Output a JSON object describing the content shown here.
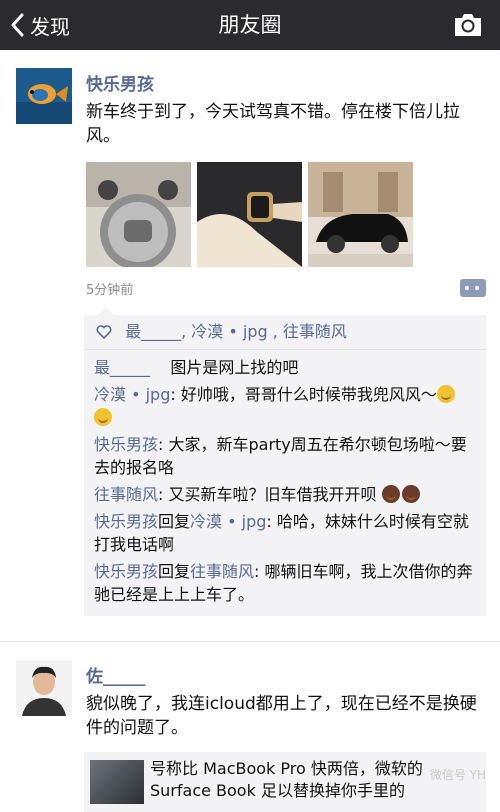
{
  "nav": {
    "back_label": "发现",
    "title": "朋友圈"
  },
  "post1": {
    "author": "快乐男孩",
    "text": "新车终于到了，今天试驾真不错。停在楼下倍儿拉风。",
    "time": "5分钟前",
    "likes": "最_____, 冷漠 • jpg , 往事随风",
    "comments": [
      {
        "name": "最_____",
        "text": "图片是网上找的吧"
      },
      {
        "name": "冷漠 • jpg",
        "text": ": 好帅哦，哥哥什么时候带我兜风风～"
      },
      {
        "name": "快乐男孩",
        "text": ": 大家，新车party周五在希尔顿包场啦～要去的报名咯"
      },
      {
        "name": "往事随风",
        "text": ": 又买新车啦？旧车借我开开呗"
      },
      {
        "name": "快乐男孩",
        "reply_word": "回复",
        "to": "冷漠 • jpg",
        "text": ": 哈哈，妹妹什么时候有空就打我电话啊"
      },
      {
        "name": "快乐男孩",
        "reply_word": "回复",
        "to": "往事随风",
        "text": ": 哪辆旧车啊，我上次借你的奔驰已经是上上上车了。"
      }
    ]
  },
  "post2": {
    "author": "佐_____",
    "text": "貌似晚了，我连icloud都用上了，现在已经不是换硬件的问题了。",
    "share_text": "号称比 MacBook Pro 快两倍，微软的 Surface Book 足以替换掉你手里的",
    "watermark": "微信号 YH"
  }
}
